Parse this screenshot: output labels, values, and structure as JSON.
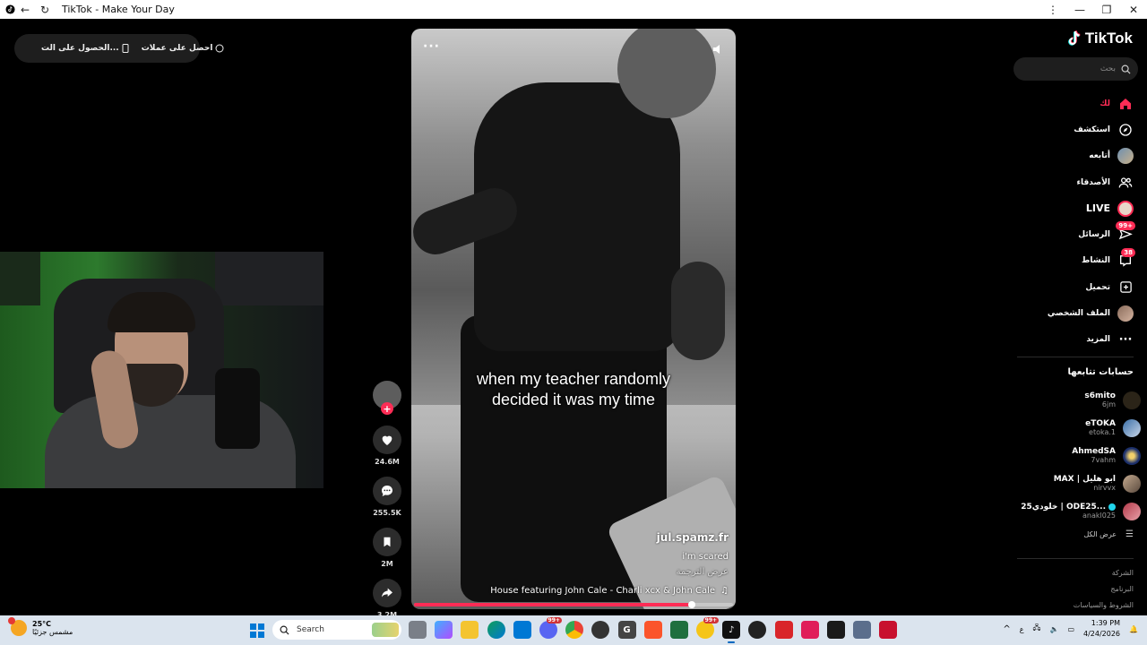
{
  "window": {
    "title": "TikTok - Make Your Day"
  },
  "top_pill": {
    "item1": "احصل على عملات",
    "item2": "الحصول على الت..."
  },
  "video": {
    "caption_line1": "when my teacher randomly",
    "caption_line2": "decided it was my time",
    "username": "jul.spamz.fr",
    "description": "i'm scared",
    "translate": "عرض الترجمة",
    "music": "House featuring John Cale - Charli xcx & John Cale",
    "progress": 0.87
  },
  "actions": {
    "likes": "24.6M",
    "comments": "255.5K",
    "saves": "2M",
    "shares": "3.2M"
  },
  "sidebar": {
    "logo": "TikTok",
    "search_placeholder": "بحث",
    "nav": [
      {
        "label": "لك",
        "icon": "home-icon"
      },
      {
        "label": "استكشف",
        "icon": "compass-icon"
      },
      {
        "label": "أتابعه",
        "icon": "avatar-icon"
      },
      {
        "label": "الأصدقاء",
        "icon": "friends-icon"
      },
      {
        "label": "LIVE",
        "icon": "live-avatar-icon"
      },
      {
        "label": "الرسائل",
        "icon": "send-icon",
        "badge": "99+"
      },
      {
        "label": "النشاط",
        "icon": "inbox-icon",
        "badge": "38"
      },
      {
        "label": "تحميل",
        "icon": "upload-icon"
      },
      {
        "label": "الملف الشخصي",
        "icon": "profile-avatar-icon"
      },
      {
        "label": "المزيد",
        "icon": "more-icon"
      }
    ],
    "following_title": "حسابات تتابعها",
    "following": [
      {
        "name": "s6mito",
        "handle": "6jm"
      },
      {
        "name": "eTOKA",
        "handle": "etoka.1"
      },
      {
        "name": "AhmedSA",
        "handle": "7vahm"
      },
      {
        "name": "MAX | ابو هليل",
        "handle": "nirvvx"
      },
      {
        "name": "خلودي25 | ODE25...",
        "handle": "anakl025"
      }
    ],
    "see_all": "عرض الكل",
    "links": [
      "الشركة",
      "البرنامج",
      "الشروط والسياسات"
    ]
  },
  "taskbar": {
    "temperature": "25°C",
    "weather": "مشمس جزئيًا",
    "search": "Search",
    "lang": "ع",
    "time": "1:39 PM",
    "date": "4/24/2026",
    "badge_a": "99+",
    "badge_b": "99+"
  },
  "colors": {
    "accent": "#fe2c55",
    "taskbar": "#dbe4ee"
  }
}
